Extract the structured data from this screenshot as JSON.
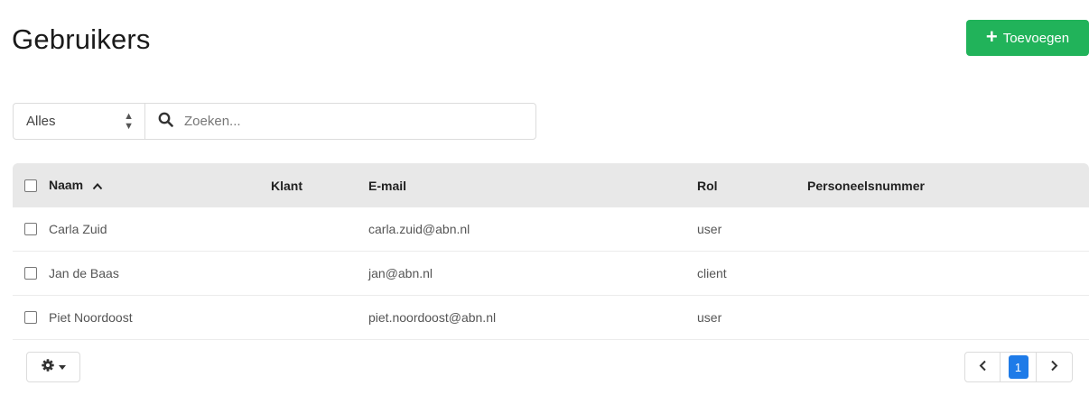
{
  "page": {
    "title": "Gebruikers",
    "add_button_label": "Toevoegen"
  },
  "filter": {
    "select_value": "Alles",
    "search_placeholder": "Zoeken..."
  },
  "table": {
    "headers": {
      "naam": "Naam",
      "klant": "Klant",
      "email": "E-mail",
      "rol": "Rol",
      "personeelsnummer": "Personeelsnummer"
    },
    "sort": {
      "column": "Naam",
      "direction": "ascending"
    },
    "rows": [
      {
        "naam": "Carla Zuid",
        "klant": "",
        "email": "carla.zuid@abn.nl",
        "rol": "user",
        "personeelsnummer": ""
      },
      {
        "naam": "Jan de Baas",
        "klant": "",
        "email": "jan@abn.nl",
        "rol": "client",
        "personeelsnummer": ""
      },
      {
        "naam": "Piet Noordoost",
        "klant": "",
        "email": "piet.noordoost@abn.nl",
        "rol": "user",
        "personeelsnummer": ""
      }
    ]
  },
  "pagination": {
    "current_page": "1"
  },
  "colors": {
    "primary_green": "#21b35a",
    "active_page_blue": "#1e7be8",
    "header_bg": "#e8e8e8"
  },
  "icons": {
    "add": "plus-icon",
    "select": "sort-arrows-icon",
    "search": "search-icon",
    "sort": "chevron-up-icon",
    "settings": "gear-icon",
    "prev": "chevron-left-icon",
    "next": "chevron-right-icon"
  }
}
